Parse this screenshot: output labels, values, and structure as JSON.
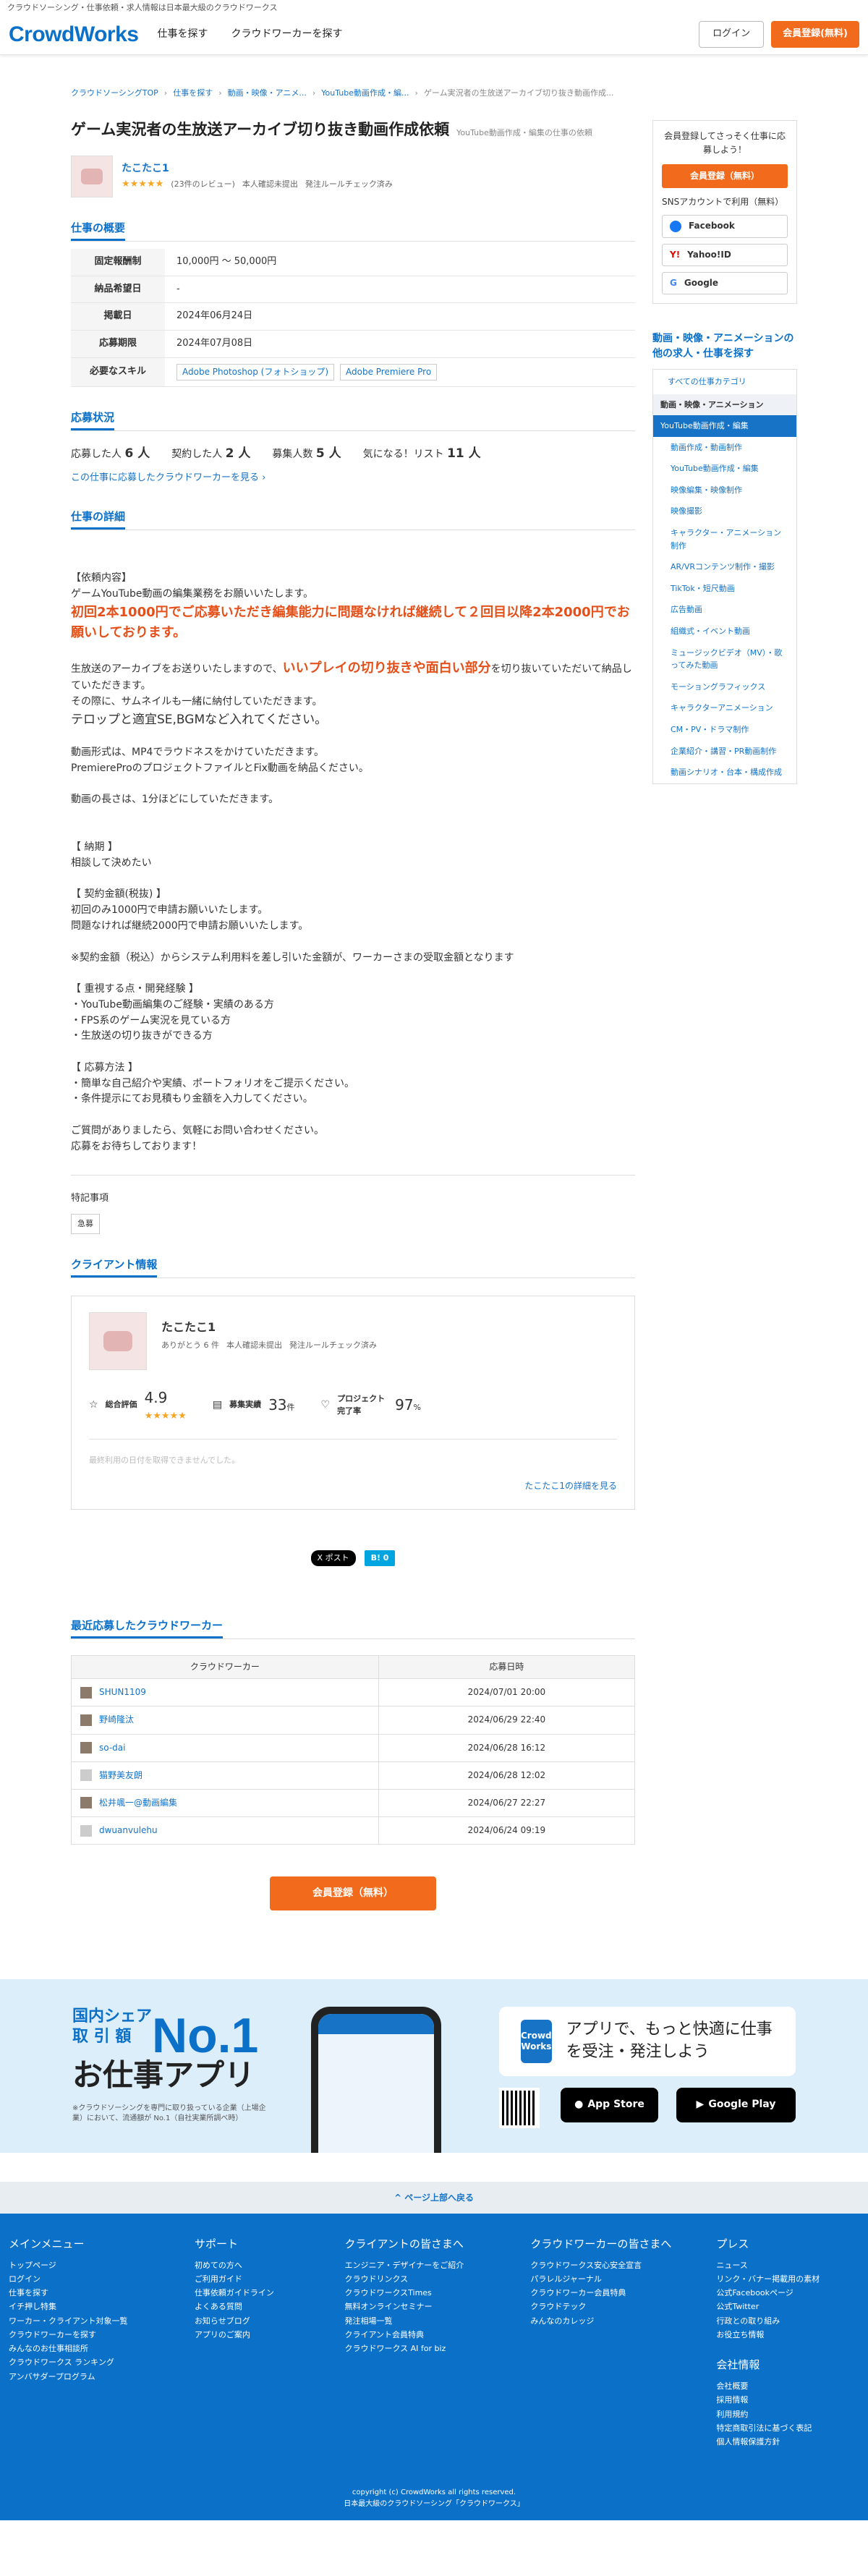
{
  "topstrip": "クラウドソーシング・仕事依頼・求人情報は日本最大級のクラウドワークス",
  "header": {
    "logo": "CrowdWorks",
    "nav": [
      "仕事を探す",
      "クラウドワーカーを探す"
    ],
    "login": "ログイン",
    "register": "会員登録(無料)"
  },
  "breadcrumb": [
    "クラウドソーシングTOP",
    "仕事を探す",
    "動画・映像・アニメ...",
    "YouTube動画作成・編...",
    "ゲーム実況者の生放送アーカイブ切り抜き動画作成..."
  ],
  "job": {
    "title": "ゲーム実況者の生放送アーカイブ切り抜き動画作成依頼",
    "category_note": "YouTube動画作成・編集の仕事の依頼",
    "client": {
      "name": "たこたこ1",
      "stars": "★★★★★",
      "reviews": "(23件のレビュー)",
      "identity": "本人確認未提出",
      "rulecheck": "発注ルールチェック済み"
    }
  },
  "summary": {
    "heading": "仕事の概要",
    "rows": [
      {
        "k": "固定報酬制",
        "v": "10,000円 〜 50,000円"
      },
      {
        "k": "納品希望日",
        "v": "-"
      },
      {
        "k": "掲載日",
        "v": "2024年06月24日"
      },
      {
        "k": "応募期限",
        "v": "2024年07月08日"
      }
    ],
    "skill_label": "必要なスキル",
    "skills": [
      "Adobe Photoshop (フォトショップ)",
      "Adobe Premiere Pro"
    ]
  },
  "status": {
    "heading": "応募状況",
    "applied_label": "応募した人",
    "applied": "6 人",
    "contracted_label": "契約した人",
    "contracted": "2 人",
    "recruit_label": "募集人数",
    "recruit": "5 人",
    "watch_label": "気になる！リスト",
    "watch": "11 人",
    "link": "この仕事に応募したクラウドワーカーを見る ›"
  },
  "detail": {
    "heading": "仕事の詳細",
    "l1": "【依頼内容】",
    "l2": "ゲームYouTube動画の編集業務をお願いいたします。",
    "red1": "初回2本1000円でご応募いただき編集能力に問題なければ継続して２回目以降2本2000円でお願いしております。",
    "l3a": "生放送のアーカイブをお送りいたしますので、",
    "l3red": "いいプレイの切り抜きや面白い部分",
    "l3b": "を切り抜いていただいて納品していただきます。",
    "l4": "その際に、サムネイルも一緒に納付していただきます。",
    "big": "テロップと適宜SE,BGMなど入れてください。",
    "l5": "動画形式は、MP4でラウドネスをかけていただきます。",
    "l6": "PremiereProのプロジェクトファイルとFix動画を納品ください。",
    "l7": "動画の長さは、1分ほどにしていただきます。",
    "l8": "【 納期 】",
    "l9": "相談して決めたい",
    "l10": "【 契約金額(税抜) 】",
    "l11": "初回のみ1000円で申請お願いいたします。",
    "l12": "問題なければ継続2000円で申請お願いいたします。",
    "l13": "※契約金額（税込）からシステム利用料を差し引いた金額が、ワーカーさまの受取金額となります",
    "l14": "【 重視する点・開発経験 】",
    "l15": "・YouTube動画編集のご経験・実績のある方",
    "l16": "・FPS系のゲーム実況を見ている方",
    "l17": "・生放送の切り抜きができる方",
    "l18": "【 応募方法 】",
    "l19": "・簡単な自己紹介や実績、ポートフォリオをご提示ください。",
    "l20": "・条件提示にてお見積もり金額を入力してください。",
    "l21": "ご質問がありましたら、気軽にお問い合わせください。",
    "l22": "応募をお待ちしております！",
    "feature_label": "特記事項",
    "tag": "急募"
  },
  "client_info": {
    "heading": "クライアント情報",
    "name": "たこたこ1",
    "thanks": "ありがとう 6 件",
    "identity": "本人確認未提出",
    "rulecheck": "発注ルールチェック済み",
    "rating_label": "総合評価",
    "rating": "4.9",
    "stars": "★★★★★",
    "record_label": "募集実績",
    "record": "33",
    "record_unit": "件",
    "complete_label": "プロジェクト完了率",
    "complete": "97",
    "complete_unit": "%",
    "note": "最終利用の日付を取得できませんでした。",
    "link": "たこたこ1の詳細を見る"
  },
  "share": {
    "x": "X ポスト",
    "hatena": "B! 0"
  },
  "recent": {
    "heading": "最近応募したクラウドワーカー",
    "col1": "クラウドワーカー",
    "col2": "応募日時",
    "rows": [
      {
        "name": "SHUN1109",
        "date": "2024/07/01 20:00"
      },
      {
        "name": "野崎隆汰",
        "date": "2024/06/29 22:40"
      },
      {
        "name": "so-dai",
        "date": "2024/06/28 16:12"
      },
      {
        "name": "猫野美友朗",
        "date": "2024/06/28 12:02"
      },
      {
        "name": "松井颯一@動画編集",
        "date": "2024/06/27 22:27"
      },
      {
        "name": "dwuanvulehu",
        "date": "2024/06/24 09:19"
      }
    ]
  },
  "bottom_register": "会員登録（無料）",
  "sidebar": {
    "lead": "会員登録してさっそく仕事に応募しよう！",
    "register": "会員登録（無料）",
    "sns_label": "SNSアカウントで利用（無料）",
    "facebook": "Facebook",
    "yahoo": "Yahoo!ID",
    "google": "Google",
    "other_heading": "動画・映像・アニメーションの他の求人・仕事を探す",
    "all": "すべての仕事カテゴリ",
    "parent": "動画・映像・アニメーション",
    "current": "YouTube動画作成・編集",
    "cats": [
      "動画作成・動画制作",
      "YouTube動画作成・編集",
      "映像編集・映像制作",
      "映像撮影",
      "キャラクター・アニメーション制作",
      "AR/VRコンテンツ制作・撮影",
      "TikTok・短尺動画",
      "広告動画",
      "組織式・イベント動画",
      "ミュージックビデオ（MV）・歌ってみた動画",
      "モーショングラフィックス",
      "キャラクターアニメーション",
      "CM・PV・ドラマ制作",
      "企業紹介・講習・PR動画制作",
      "動画シナリオ・台本・構成作成"
    ]
  },
  "app": {
    "share1": "国内シェア",
    "share2": "取 引 額",
    "no1": "No.1",
    "title": "お仕事アプリ",
    "note": "※クラウドソーシングを専門に取り扱っている企業（上場企業）において、流通額が No.1（自社実業所調べ時）",
    "cw": "Crowd Works",
    "promo": "アプリで、もっと快適に仕事を受注・発注しよう",
    "appstore": "App Store",
    "googleplay": "Google Play"
  },
  "backtop": "^ ページ上部へ戻る",
  "footer": {
    "cols": [
      {
        "h": "メインメニュー",
        "items": [
          "トップページ",
          "ログイン",
          "仕事を探す",
          "イチ押し特集",
          "ワーカー・クライアント対象一覧",
          "クラウドワーカーを探す",
          "みんなのお仕事相談所",
          "クラウドワークス ランキング",
          "アンバサダープログラム"
        ]
      },
      {
        "h": "サポート",
        "items": [
          "初めての方へ",
          "ご利用ガイド",
          "仕事依頼ガイドライン",
          "よくある質問",
          "お知らせブログ",
          "アプリのご案内"
        ]
      },
      {
        "h": "クライアントの皆さまへ",
        "items": [
          "エンジニア・デザイナーをご紹介",
          "クラウドリンクス",
          "クラウドワークスTimes",
          "無料オンラインセミナー",
          "発注相場一覧",
          "クライアント会員特典",
          "クラウドワークス AI for biz"
        ]
      },
      {
        "h": "クラウドワーカーの皆さまへ",
        "items": [
          "クラウドワークス安心安全宣言",
          "パラレルジャーナル",
          "クラウドワーカー会員特典",
          "クラウドテック",
          "みんなのカレッジ"
        ]
      },
      {
        "h": "プレス",
        "items": [
          "ニュース",
          "リンク・バナー掲載用の素材",
          "公式Facebookページ",
          "公式Twitter",
          "行政との取り組み",
          "お役立ち情報"
        ],
        "h2": "会社情報",
        "items2": [
          "会社概要",
          "採用情報",
          "利用規約",
          "特定商取引法に基づく表記",
          "個人情報保護方針"
        ]
      }
    ],
    "copy": "copyright (c) CrowdWorks all rights reserved.",
    "tagline": "日本最大級のクラウドソーシング「クラウドワークス」"
  }
}
